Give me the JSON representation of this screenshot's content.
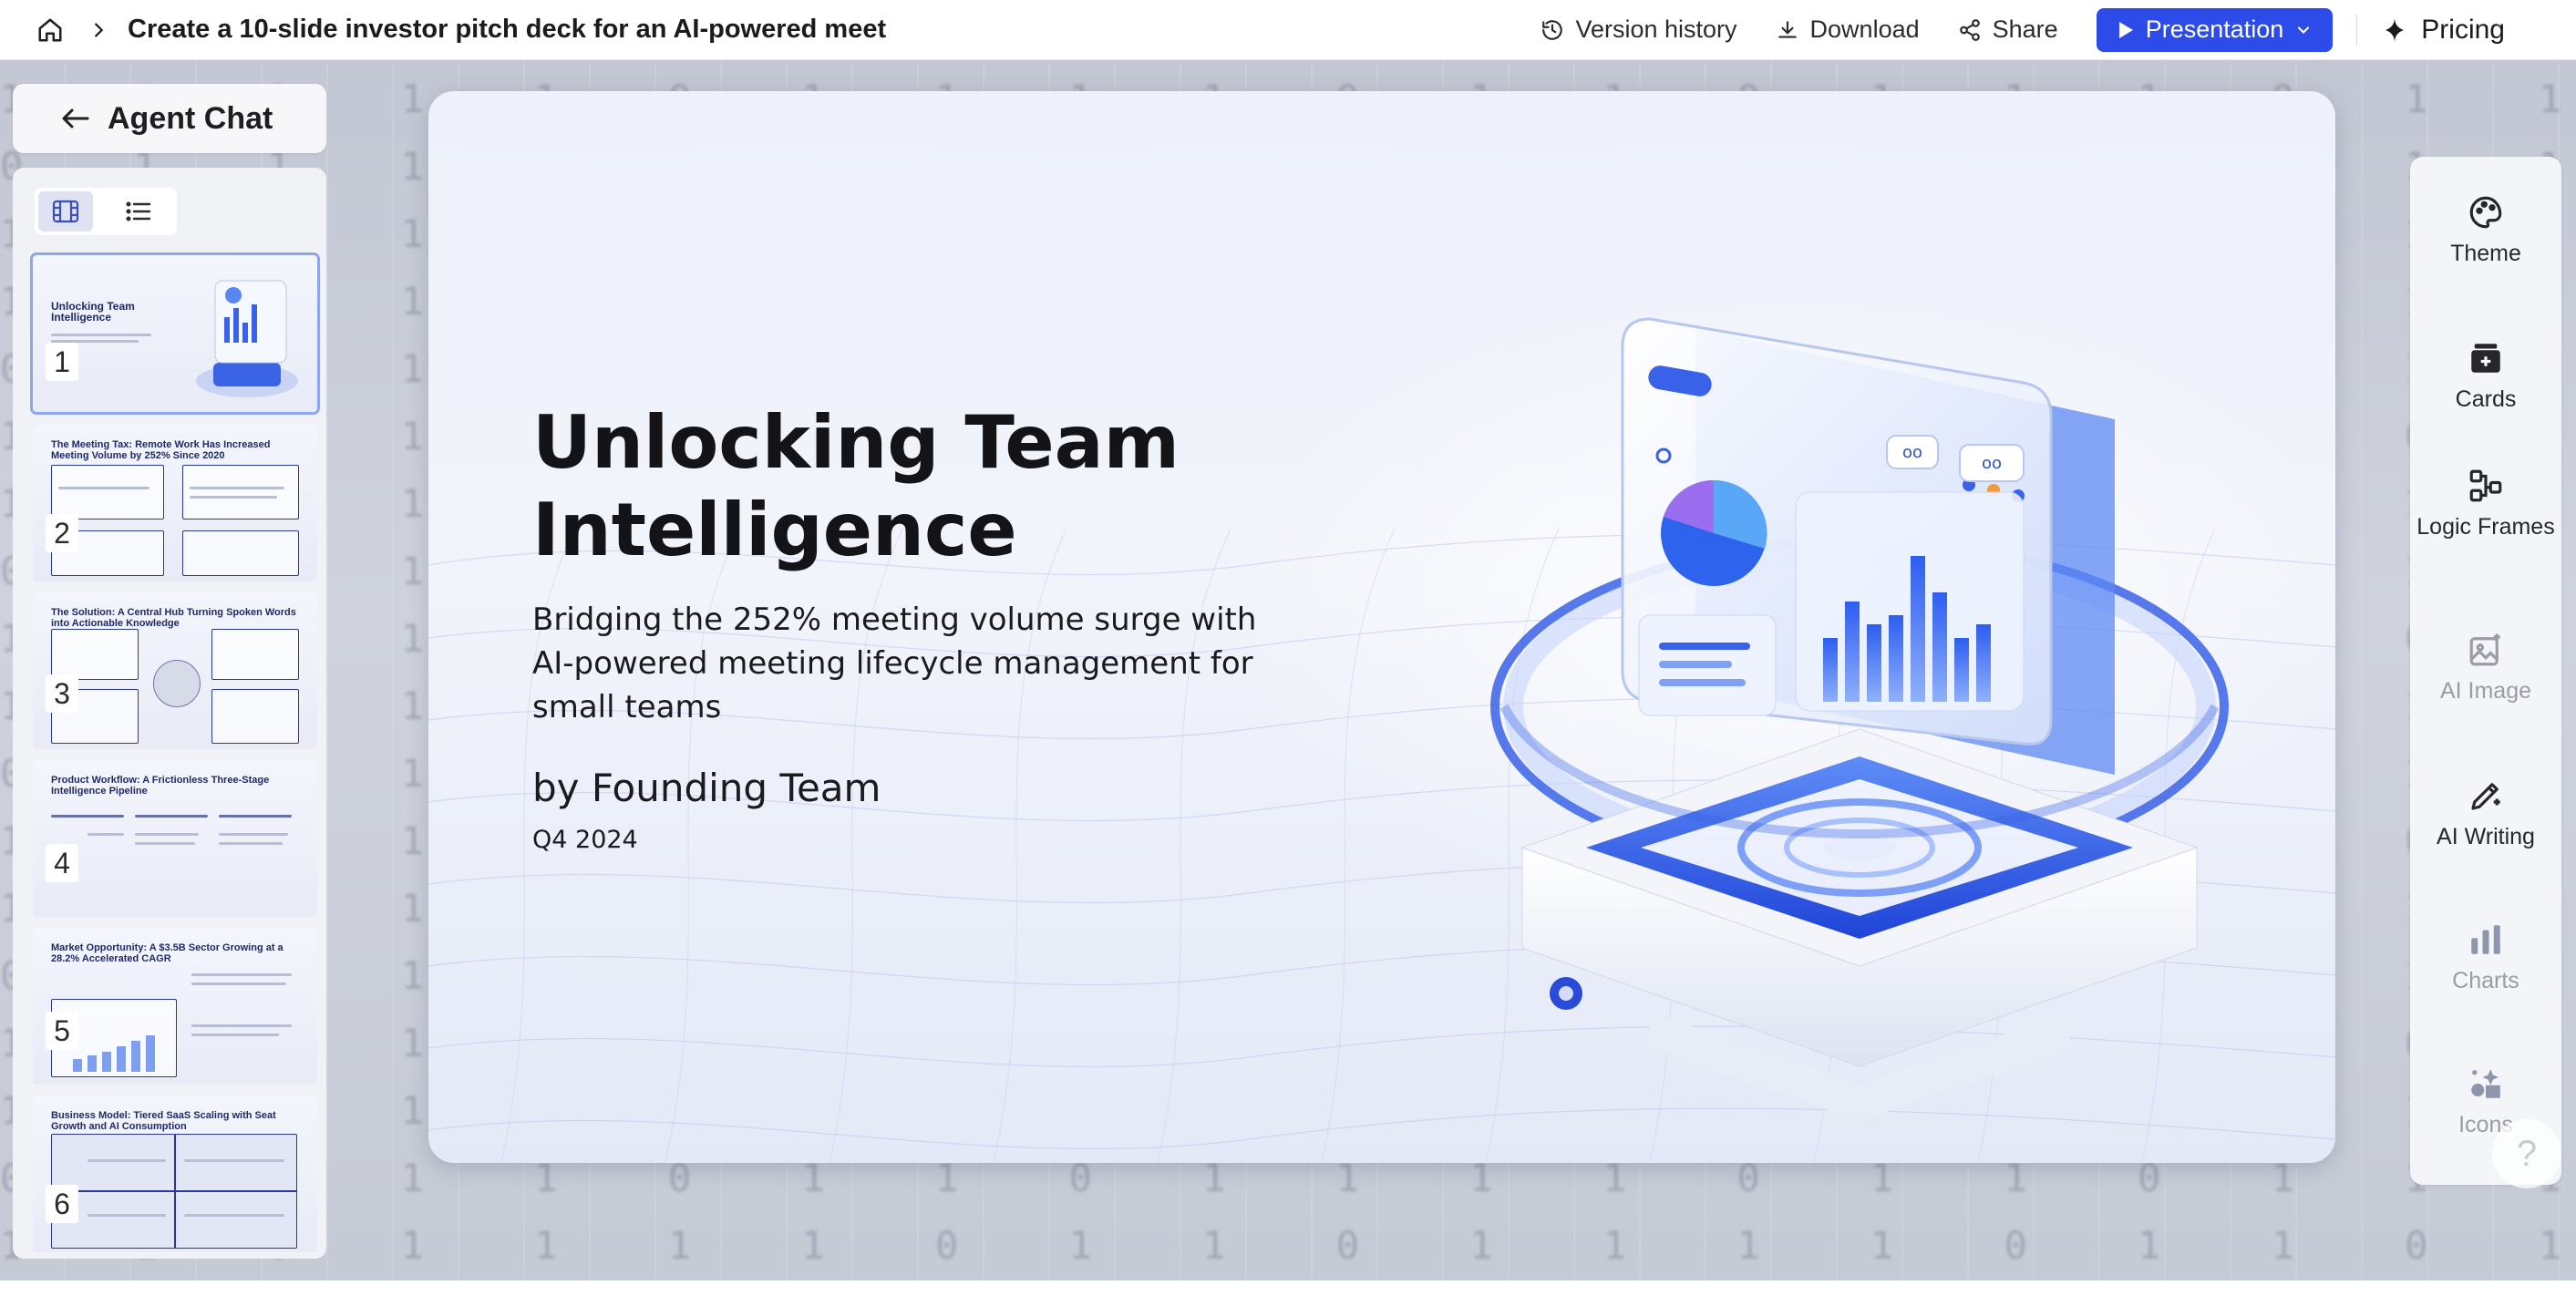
{
  "header": {
    "doc_title": "Create a 10-slide investor pitch deck for an AI-powered meet",
    "version_history": "Version history",
    "download": "Download",
    "share": "Share",
    "presentation": "Presentation",
    "pricing": "Pricing",
    "accent_color": "#2c4be8"
  },
  "sidebar": {
    "agent_chat": "Agent Chat",
    "view_modes": [
      "grid-view-icon",
      "list-view-icon"
    ],
    "thumbnails": [
      {
        "num": "1",
        "title": "Unlocking Team Intelligence"
      },
      {
        "num": "2",
        "title": "The Meeting Tax: Remote Work Has Increased Meeting Volume by 252% Since 2020"
      },
      {
        "num": "3",
        "title": "The Solution: A Central Hub Turning Spoken Words into Actionable Knowledge"
      },
      {
        "num": "4",
        "title": "Product Workflow: A Frictionless Three-Stage Intelligence Pipeline"
      },
      {
        "num": "5",
        "title": "Market Opportunity: A $3.5B Sector Growing at a 28.2% Accelerated CAGR"
      },
      {
        "num": "6",
        "title": "Business Model: Tiered SaaS Scaling with Seat Growth and AI Consumption"
      }
    ]
  },
  "slide": {
    "title_line1": "Unlocking Team",
    "title_line2": "Intelligence",
    "subtitle": "Bridging the 252% meeting volume surge with AI-powered meeting lifecycle management for small teams",
    "byline": "by Founding Team",
    "date": "Q4 2024"
  },
  "tools": [
    {
      "label": "Theme",
      "icon": "palette-icon",
      "enabled": true
    },
    {
      "label": "Cards",
      "icon": "cards-icon",
      "enabled": true
    },
    {
      "label": "Logic Frames",
      "icon": "logic-frames-icon",
      "enabled": true
    },
    {
      "label": "AI Image",
      "icon": "ai-image-icon",
      "enabled": false
    },
    {
      "label": "AI Writing",
      "icon": "ai-writing-icon",
      "enabled": true
    },
    {
      "label": "Charts",
      "icon": "bar-chart-icon",
      "enabled": false
    },
    {
      "label": "Icons",
      "icon": "icons-icon",
      "enabled": false
    }
  ],
  "help": "?"
}
